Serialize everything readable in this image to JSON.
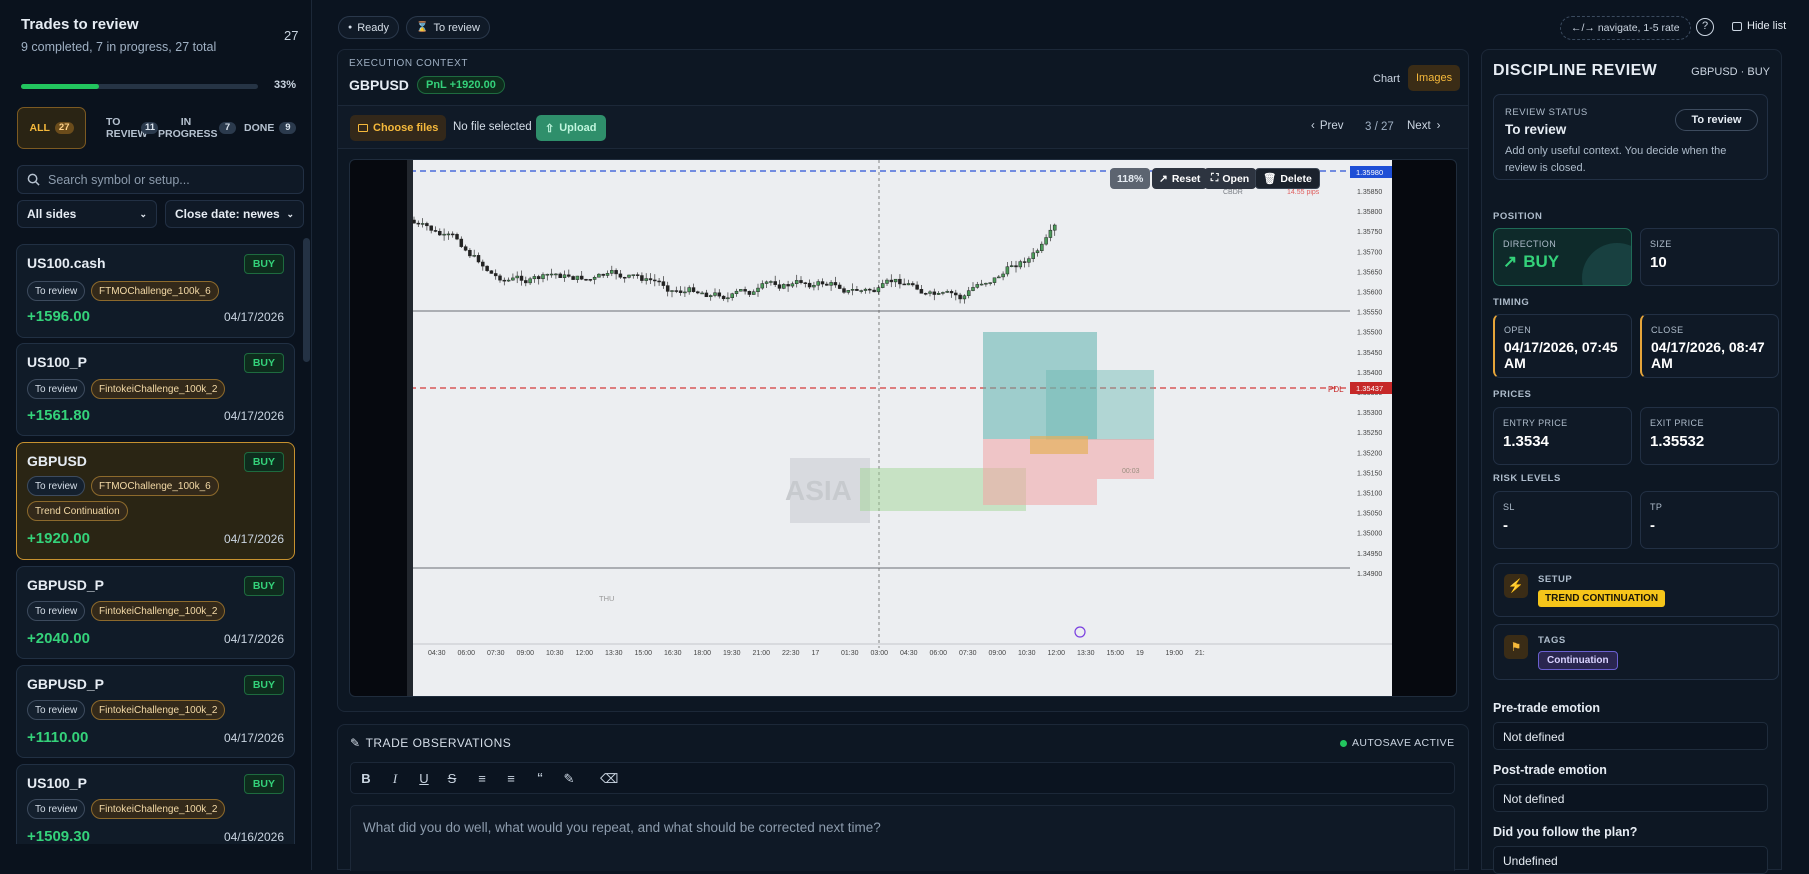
{
  "left_panel": {
    "title": "Trades to review",
    "subtitle": "9 completed, 7 in progress, 27 total",
    "count": "27",
    "progress_percent": 33,
    "progress_label": "33%",
    "filters": [
      {
        "label": "ALL",
        "count": "27"
      },
      {
        "label": "TO REVIEW",
        "count": "11"
      },
      {
        "label": "IN PROGRESS",
        "count": "7"
      },
      {
        "label": "DONE",
        "count": "9"
      }
    ],
    "search_placeholder": "Search symbol or setup...",
    "side_select": "All sides",
    "sort_select": "Close date: newes"
  },
  "trades": [
    {
      "symbol": "US100.cash",
      "side": "BUY",
      "status": "To review",
      "account": "FTMOChallenge_100k_6",
      "setup": "",
      "pnl": "+1596.00",
      "date": "04/17/2026"
    },
    {
      "symbol": "US100_P",
      "side": "BUY",
      "status": "To review",
      "account": "FintokeiChallenge_100k_2",
      "setup": "",
      "pnl": "+1561.80",
      "date": "04/17/2026"
    },
    {
      "symbol": "GBPUSD",
      "side": "BUY",
      "status": "To review",
      "account": "FTMOChallenge_100k_6",
      "setup": "Trend Continuation",
      "pnl": "+1920.00",
      "date": "04/17/2026"
    },
    {
      "symbol": "GBPUSD_P",
      "side": "BUY",
      "status": "To review",
      "account": "FintokeiChallenge_100k_2",
      "setup": "",
      "pnl": "+2040.00",
      "date": "04/17/2026"
    },
    {
      "symbol": "GBPUSD_P",
      "side": "BUY",
      "status": "To review",
      "account": "FintokeiChallenge_100k_2",
      "setup": "",
      "pnl": "+1110.00",
      "date": "04/17/2026"
    },
    {
      "symbol": "US100_P",
      "side": "BUY",
      "status": "To review",
      "account": "FintokeiChallenge_100k_2",
      "setup": "",
      "pnl": "+1509.30",
      "date": "04/16/2026"
    }
  ],
  "topbar": {
    "ready": "Ready",
    "status": "To review",
    "hint": "←/→ navigate, 1-5 rate",
    "hide_list": "Hide list"
  },
  "context": {
    "section_label": "EXECUTION CONTEXT",
    "symbol": "GBPUSD",
    "pnl": "PnL +1920.00",
    "tab_chart": "Chart",
    "tab_images": "Images",
    "choose_files": "Choose files",
    "no_file": "No file selected",
    "upload": "Upload",
    "prev": "Prev",
    "counter": "3 / 27",
    "next": "Next",
    "zoom": "118%",
    "reset": "Reset",
    "open": "Open",
    "delete": "Delete"
  },
  "screenshot": {
    "price_labels": [
      "1.35850",
      "1.35800",
      "1.35750",
      "1.35700",
      "1.35650",
      "1.35600",
      "1.35550",
      "1.35500",
      "1.35450",
      "1.35400",
      "1.35350",
      "1.35300",
      "1.35250",
      "1.35200",
      "1.35150",
      "1.35100",
      "1.35050",
      "1.35000",
      "1.34950",
      "1.34900"
    ],
    "time_labels": [
      "04:30",
      "06:00",
      "07:30",
      "09:00",
      "10:30",
      "12:00",
      "13:30",
      "15:00",
      "16:30",
      "18:00",
      "19:30",
      "21:00",
      "22:30",
      "17",
      "01:30",
      "03:00",
      "04:30",
      "06:00",
      "07:30",
      "09:00",
      "10:30",
      "12:00",
      "13:30",
      "15:00",
      "19",
      "19:00",
      "21:"
    ],
    "pdl_label": "PDL",
    "pdl_price": "1.35437",
    "top_price": "1.35980",
    "corner_text": "CBDR",
    "pips_text": "14.55 pips",
    "box_text": "00:03",
    "session_text": "ASIA",
    "day_text": "THU"
  },
  "observations": {
    "title": "TRADE OBSERVATIONS",
    "autosave": "AUTOSAVE ACTIVE",
    "placeholder": "What did you do well, what would you repeat, and what should be corrected next time?"
  },
  "review": {
    "title": "DISCIPLINE REVIEW",
    "symbol_side": "GBPUSD · BUY",
    "status_label": "REVIEW STATUS",
    "status_value": "To review",
    "status_button": "To review",
    "status_note": "Add only useful context. You decide when the review is closed.",
    "position_label": "POSITION",
    "direction_label": "DIRECTION",
    "direction_value": "BUY",
    "size_label": "SIZE",
    "size_value": "10",
    "timing_label": "TIMING",
    "open_label": "OPEN",
    "open_value": "04/17/2026, 07:45 AM",
    "close_label": "CLOSE",
    "close_value": "04/17/2026, 08:47 AM",
    "prices_label": "PRICES",
    "entry_label": "ENTRY PRICE",
    "entry_value": "1.3534",
    "exit_label": "EXIT PRICE",
    "exit_value": "1.35532",
    "risk_label": "RISK LEVELS",
    "sl_label": "SL",
    "sl_value": "-",
    "tp_label": "TP",
    "tp_value": "-",
    "setup_label": "SETUP",
    "setup_value": "TREND CONTINUATION",
    "tags_label": "TAGS",
    "tag_value": "Continuation",
    "pre_emotion_label": "Pre-trade emotion",
    "pre_emotion_value": "Not defined",
    "post_emotion_label": "Post-trade emotion",
    "post_emotion_value": "Not defined",
    "plan_label": "Did you follow the plan?",
    "plan_value": "Undefined"
  },
  "colors": {
    "accent": "#f6b93b",
    "profit": "#34d27a",
    "background": "#0b1420"
  }
}
